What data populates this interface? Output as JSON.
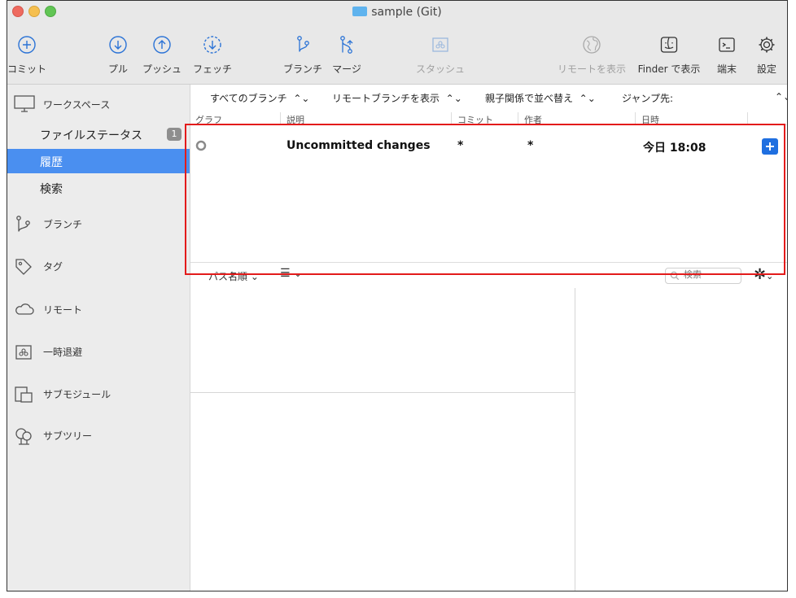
{
  "window": {
    "title": "sample (Git)"
  },
  "toolbar": {
    "commit": "コミット",
    "pull": "プル",
    "push": "プッシュ",
    "fetch": "フェッチ",
    "branch": "ブランチ",
    "merge": "マージ",
    "stash": "スタッシュ",
    "show_remote": "リモートを表示",
    "show_in_finder": "Finder で表示",
    "terminal": "端末",
    "settings": "設定"
  },
  "sidebar": {
    "workspace": "ワークスペース",
    "file_status": "ファイルステータス",
    "file_status_badge": "1",
    "history": "履歴",
    "search": "検索",
    "branches": "ブランチ",
    "tags": "タグ",
    "remotes": "リモート",
    "stashes": "一時退避",
    "submodules": "サブモジュール",
    "subtrees": "サブツリー"
  },
  "filters": {
    "all_branches": "すべてのブランチ",
    "show_remote_branches": "リモートブランチを表示",
    "sort_by_parent": "親子関係で並べ替え",
    "jump_to": "ジャンプ先:"
  },
  "columns": {
    "graph": "グラフ",
    "description": "説明",
    "commit": "コミット",
    "author": "作者",
    "date": "日時"
  },
  "commit_row": {
    "description": "Uncommitted changes",
    "commit": "*",
    "author": "*",
    "date": "今日 18:08"
  },
  "path_bar": {
    "sort": "パス名順",
    "search_placeholder": "検索"
  },
  "colors": {
    "accent": "#4a8ff0",
    "highlight_box": "#e31b1b"
  }
}
